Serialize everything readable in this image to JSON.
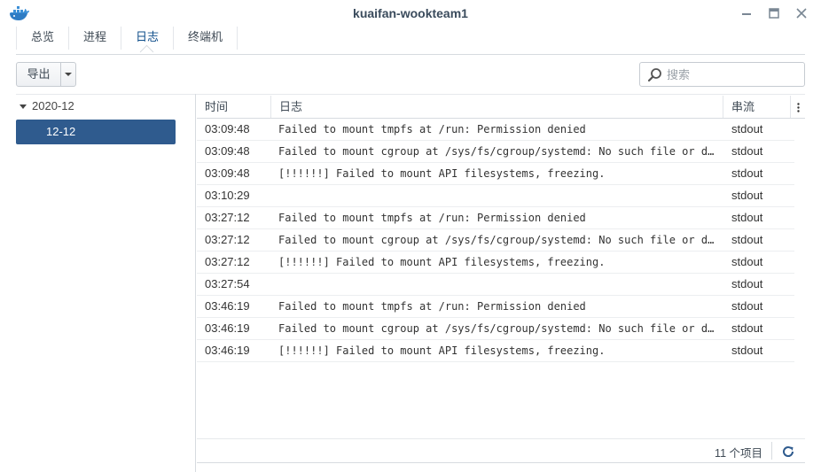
{
  "window": {
    "title": "kuaifan-wookteam1",
    "icon": "docker-whale-icon"
  },
  "tabs": [
    {
      "label": "总览"
    },
    {
      "label": "进程"
    },
    {
      "label": "日志",
      "active": true
    },
    {
      "label": "终端机"
    }
  ],
  "toolbar": {
    "export_label": "导出"
  },
  "search": {
    "placeholder": "搜索",
    "value": ""
  },
  "tree": {
    "parent": "2020-12",
    "child": "12-12"
  },
  "grid": {
    "headers": {
      "time": "时间",
      "log": "日志",
      "stream": "串流"
    },
    "rows": [
      {
        "time": "03:09:48",
        "log": "Failed to mount tmpfs at /run: Permission denied",
        "stream": "stdout"
      },
      {
        "time": "03:09:48",
        "log": "Failed to mount cgroup at /sys/fs/cgroup/systemd: No such file or directory",
        "stream": "stdout"
      },
      {
        "time": "03:09:48",
        "log": "[!!!!!!] Failed to mount API filesystems, freezing.",
        "stream": "stdout"
      },
      {
        "time": "03:10:29",
        "log": "",
        "stream": "stdout"
      },
      {
        "time": "03:27:12",
        "log": "Failed to mount tmpfs at /run: Permission denied",
        "stream": "stdout"
      },
      {
        "time": "03:27:12",
        "log": "Failed to mount cgroup at /sys/fs/cgroup/systemd: No such file or directory",
        "stream": "stdout"
      },
      {
        "time": "03:27:12",
        "log": "[!!!!!!] Failed to mount API filesystems, freezing.",
        "stream": "stdout"
      },
      {
        "time": "03:27:54",
        "log": "",
        "stream": "stdout"
      },
      {
        "time": "03:46:19",
        "log": "Failed to mount tmpfs at /run: Permission denied",
        "stream": "stdout"
      },
      {
        "time": "03:46:19",
        "log": "Failed to mount cgroup at /sys/fs/cgroup/systemd: No such file or directory",
        "stream": "stdout"
      },
      {
        "time": "03:46:19",
        "log": "[!!!!!!] Failed to mount API filesystems, freezing.",
        "stream": "stdout"
      }
    ]
  },
  "footer": {
    "count": "11 个项目"
  },
  "colors": {
    "selected": "#2f5b8e",
    "title": "#3a4b5c",
    "border": "#d7dbe0"
  }
}
